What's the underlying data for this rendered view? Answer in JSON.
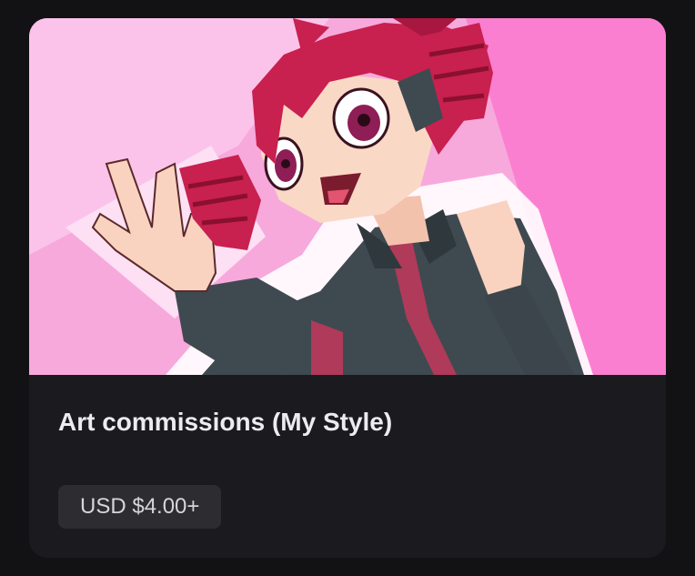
{
  "product": {
    "title": "Art commissions (My Style)",
    "price": "USD $4.00+",
    "image_icon": "anime-character-waving-illustration"
  },
  "colors": {
    "page_background": "#121215",
    "card_background": "#1b1b1f",
    "price_badge_background": "#2c2c31",
    "title_text": "#ececef",
    "image_background": "#f7a9dc",
    "hair": "#c8204f",
    "outfit": "#3f4a50"
  }
}
